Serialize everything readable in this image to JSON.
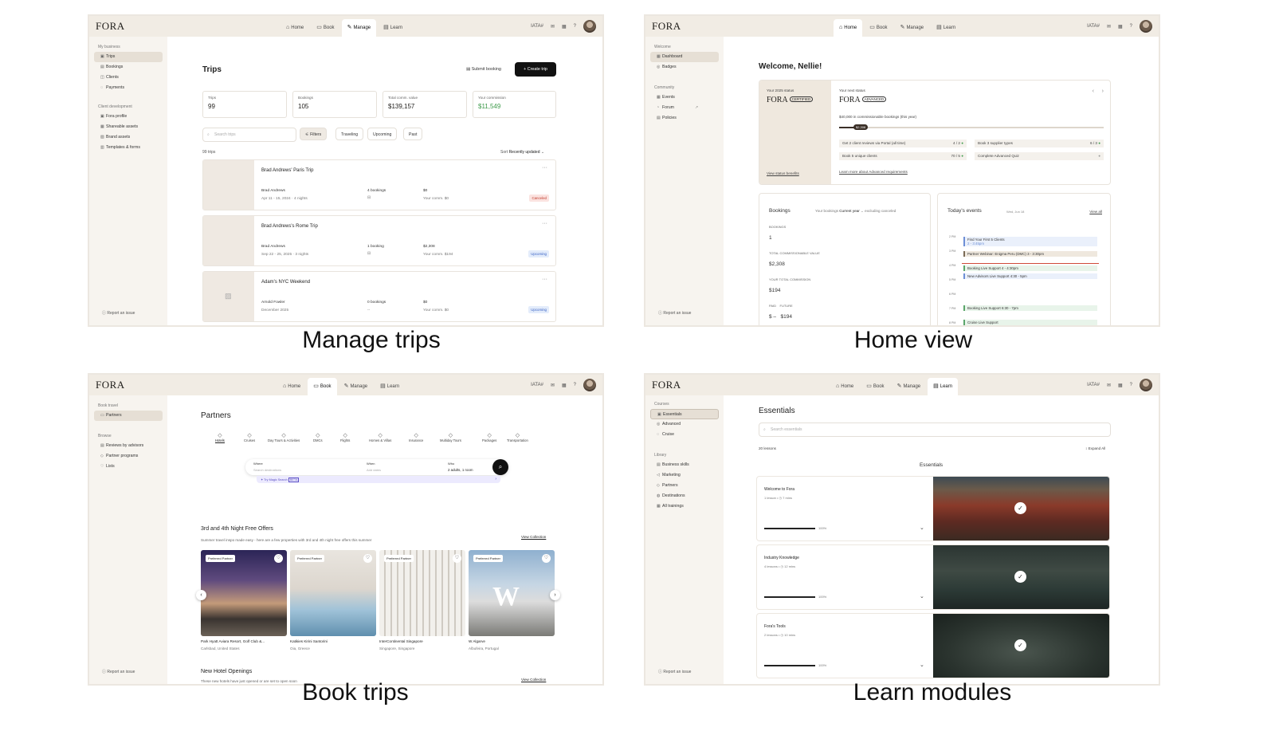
{
  "captions": {
    "manage": "Manage trips",
    "home": "Home view",
    "book": "Book trips",
    "learn": "Learn modules"
  },
  "common": {
    "logo": "FORA",
    "nav": [
      "Home",
      "Book",
      "Manage",
      "Learn"
    ],
    "iata": "IATA#",
    "report": "Report an issue"
  },
  "manage": {
    "sidebar": {
      "group1": "My business",
      "items1": [
        "Trips",
        "Bookings",
        "Clients",
        "Payments"
      ],
      "group2": "Client development",
      "items2": [
        "Fora profile",
        "Shareable assets",
        "Brand assets",
        "Templates & forms"
      ]
    },
    "title": "Trips",
    "submit_booking": "Submit booking",
    "create_trip": "+ Create trip",
    "stats": [
      {
        "label": "Trips",
        "value": "99"
      },
      {
        "label": "Bookings",
        "value": "105"
      },
      {
        "label": "Total comm. value",
        "value": "$139,157"
      },
      {
        "label": "Your commission",
        "value": "$11,549"
      }
    ],
    "search_placeholder": "Search trips",
    "filters": [
      "Filters",
      "Traveling",
      "Upcoming",
      "Past"
    ],
    "count": "99 trips",
    "sort_label": "Sort",
    "sort_value": "Recently updated",
    "trips": [
      {
        "name": "Brad Andrews' Paris Trip",
        "client": "Brad Andrews",
        "dates": "Apr 11 - 15, 2024  ·  4 nights",
        "bookings": "4 bookings",
        "amount": "$0",
        "comm": "Your comm. $0",
        "status": "Canceled"
      },
      {
        "name": "Brad Andrews's Rome Trip",
        "client": "Brad Andrews",
        "dates": "Sep 22 - 25, 2025  ·  3 nights",
        "bookings": "1 booking",
        "amount": "$2,308",
        "comm": "Your comm. $194",
        "status": "Upcoming"
      },
      {
        "name": "Adam's NYC Weekend",
        "client": "Arnold Fowler",
        "dates": "December 2025",
        "bookings": "0 bookings",
        "amount": "$0",
        "comm": "Your comm. $0",
        "status": "Upcoming"
      }
    ]
  },
  "home": {
    "sidebar": {
      "group1": "Welcome",
      "items1": [
        "Dashboard",
        "Badges"
      ],
      "group2": "Community",
      "items2": [
        "Events",
        "Forum",
        "Policies"
      ]
    },
    "welcome": "Welcome, Nellie!",
    "status_label": "Your 2025 status",
    "status_logo": "FORA",
    "status_badge": "CERTIFIED",
    "view_benefits": "View status benefits",
    "next_label": "Your next status",
    "next_badge": "ADVANCED",
    "progress_text": "$40,000 in commissionable bookings (this year)",
    "progress_value": "$2,308",
    "progress_fraction": 0.06,
    "reqs": [
      {
        "text": "Get 2 client reviews via Portal (all time)",
        "count": "4 / 2"
      },
      {
        "text": "Book 3 supplier types",
        "count": "6 / 3"
      },
      {
        "text": "Book 5 unique clients",
        "count": "70 / 5"
      },
      {
        "text": "Complete Advanced Quiz",
        "count": ""
      }
    ],
    "learn_more": "Learn more about Advanced requirements",
    "bookings_title": "Bookings",
    "bookings_filter": "Your bookings",
    "bookings_year": "Current year",
    "bookings_excl": "excluding canceled",
    "metrics": [
      {
        "label": "BOOKINGS",
        "value": "1"
      },
      {
        "label": "TOTAL COMMISSIONABLE VALUE",
        "value": "$2,308"
      },
      {
        "label": "YOUR TOTAL COMMISSION",
        "value": "$194"
      }
    ],
    "paid_label": "PAID",
    "future_label": "FUTURE",
    "paid_value": "$ –",
    "future_value": "$194",
    "events_title": "Today's events",
    "events_date": "Wed, Jun 18",
    "view_all": "View all",
    "times": [
      "2 PM",
      "3 PM",
      "4 PM",
      "5 PM",
      "6 PM",
      "7 PM",
      "8 PM"
    ],
    "events": [
      {
        "title": "Find Your First 5 Clients",
        "time": "2 - 3:45pm",
        "color": "#6d8fd6"
      },
      {
        "title": "Partner Webinar: Enigma Peru (DMC) 3 - 3:30pm",
        "time": "",
        "color": "#7a6a55"
      },
      {
        "title": "Booking Live Support 4 - 4:30pm",
        "time": "",
        "color": "#5aa56a"
      },
      {
        "title": "New Advisors Live Support 4:30 - 5pm",
        "time": "",
        "color": "#6d8fd6"
      },
      {
        "title": "Booking Live Support 6:30 - 7pm",
        "time": "",
        "color": "#5aa56a"
      },
      {
        "title": "Cruise Live Support",
        "time": "7:30 - 8:15pm",
        "color": "#5aa56a"
      }
    ]
  },
  "book": {
    "sidebar": {
      "group1": "Book travel",
      "items1": [
        "Partners"
      ],
      "group2": "Browse",
      "items2": [
        "Reviews by advisors",
        "Partner programs",
        "Lists"
      ]
    },
    "title": "Partners",
    "categories": [
      "Hotels",
      "Cruises",
      "Day Tours & Activities",
      "DMCs",
      "Flights",
      "Homes & Villas",
      "Insurance",
      "Multiday Tours",
      "Packages",
      "Transportation"
    ],
    "where_label": "Where",
    "where_ph": "Search destinations",
    "when_label": "When",
    "when_ph": "Add dates",
    "who_label": "Who",
    "who_value": "2 adults, 1 room",
    "magic": "Try Magic Search",
    "beta": "BETA",
    "section1_title": "3rd and 4th Night Free Offers",
    "section1_sub": "Summer travel inspo made easy - here are a few properties with 3rd and 4th night free offers this summer",
    "view_collection": "View Collection",
    "preferred": "Preferred Partner",
    "hotels": [
      {
        "name": "Park Hyatt Aviara Resort, Golf Club &...",
        "loc": "Carlsbad, United States"
      },
      {
        "name": "Katikies Kirini Santorini",
        "loc": "Oia, Greece"
      },
      {
        "name": "InterContinental Singapore",
        "loc": "Singapore, Singapore"
      },
      {
        "name": "W Algarve",
        "loc": "Albufeira, Portugal"
      }
    ],
    "section2_title": "New Hotel Openings",
    "section2_sub": "These new hotels have just opened or are set to open soon"
  },
  "learn": {
    "sidebar": {
      "group1": "Courses",
      "items1": [
        "Essentials",
        "Advanced",
        "Cruise"
      ],
      "group2": "Library",
      "items2": [
        "Business skills",
        "Marketing",
        "Partners",
        "Destinations",
        "All trainings"
      ]
    },
    "title": "Essentials",
    "search_ph": "Search essentials",
    "lessons_count": "20 lessons",
    "expand_all": "Expand All",
    "section": "Essentials",
    "modules": [
      {
        "name": "Welcome to Fora",
        "lessons": "1 lesson",
        "time": "7 mins",
        "progress": "100%",
        "progress_fraction": 1
      },
      {
        "name": "Industry Knowledge",
        "lessons": "4 lessons",
        "time": "12 mins",
        "progress": "100%",
        "progress_fraction": 1
      },
      {
        "name": "Fora's Tools",
        "lessons": "2 lessons",
        "time": "10 mins",
        "progress": "100%",
        "progress_fraction": 1
      }
    ]
  }
}
